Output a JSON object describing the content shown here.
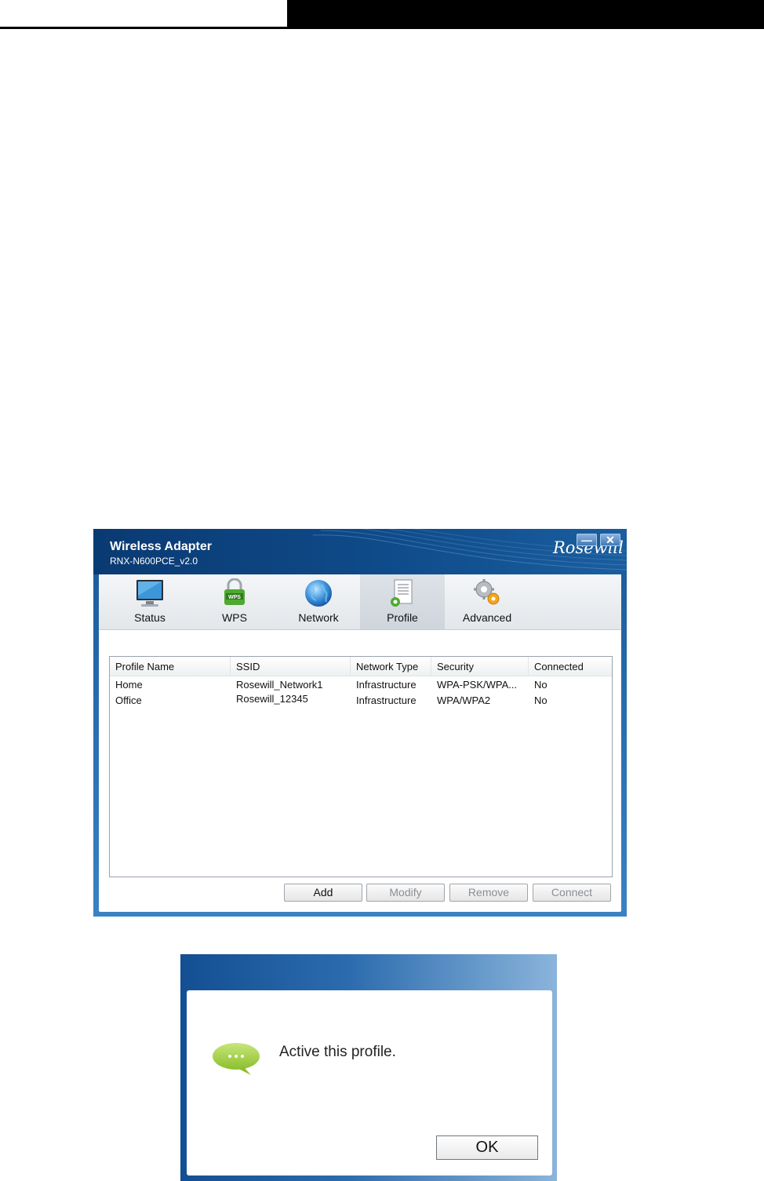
{
  "window": {
    "title": "Wireless Adapter",
    "subtitle": "RNX-N600PCE_v2.0",
    "brand": "Rosewill",
    "minimize_glyph": "—",
    "close_glyph": "✕"
  },
  "tabs": [
    {
      "label": "Status",
      "icon": "monitor-icon",
      "active": false
    },
    {
      "label": "WPS",
      "icon": "wps-lock-icon",
      "active": false
    },
    {
      "label": "Network",
      "icon": "globe-icon",
      "active": false
    },
    {
      "label": "Profile",
      "icon": "profile-document-icon",
      "active": true
    },
    {
      "label": "Advanced",
      "icon": "gears-icon",
      "active": false
    }
  ],
  "table": {
    "columns": [
      "Profile Name",
      "SSID",
      "Network Type",
      "Security",
      "Connected"
    ],
    "rows": [
      [
        "Home",
        "Rosewill_Network1",
        "Infrastructure",
        "WPA-PSK/WPA...",
        "No"
      ],
      [
        "Office",
        "Rosewill_12345",
        "Infrastructure",
        "WPA/WPA2",
        "No"
      ]
    ]
  },
  "buttons": {
    "add": "Add",
    "modify": "Modify",
    "remove": "Remove",
    "connect": "Connect"
  },
  "dialog": {
    "message": "Active this profile.",
    "ok": "OK",
    "icon": "speech-bubble-icon"
  },
  "colors": {
    "window_blue": "#0f4b8a",
    "dialog_blue": "#2c6cae",
    "bubble_green": "#9ccc3c"
  }
}
